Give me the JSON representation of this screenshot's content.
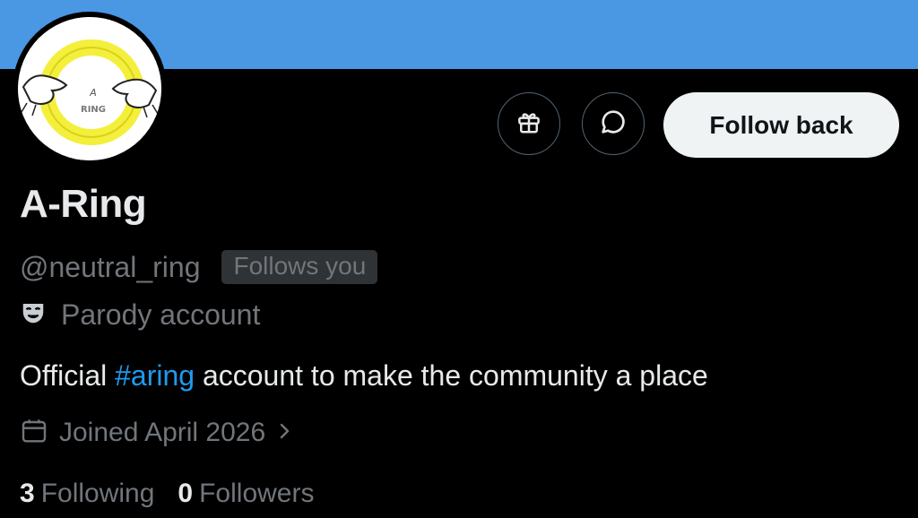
{
  "profile": {
    "name": "A-Ring",
    "handle": "@neutral_ring",
    "follows_you_badge": "Follows you",
    "parody_label": "Parody account",
    "bio": {
      "prefix": "Official ",
      "hashtag": "#aring",
      "suffix": " account to make the community a place"
    },
    "joined": "Joined April 2026",
    "following_count": "3",
    "following_label": "Following",
    "followers_count": "0",
    "followers_label": "Followers",
    "avatar_text_top": "A",
    "avatar_text_bottom": "RING"
  },
  "actions": {
    "follow_back_label": "Follow back",
    "gift_icon": "gift-icon",
    "message_icon": "message-icon"
  },
  "colors": {
    "banner": "#4a97e3",
    "background": "#000000",
    "accent_link": "#1d9bf0",
    "secondary_text": "#71767b",
    "primary_text": "#e7e9ea",
    "button_bg": "#eff3f4"
  }
}
